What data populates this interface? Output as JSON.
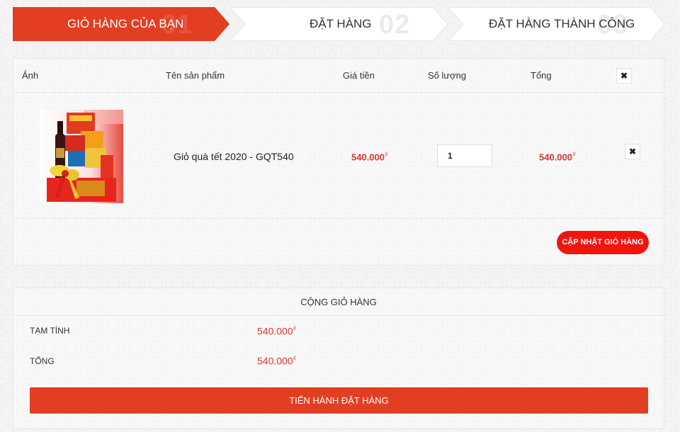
{
  "steps": [
    {
      "label": "GIỎ HÀNG CỦA BẠN",
      "number": "01",
      "active": true
    },
    {
      "label": "ĐẶT HÀNG",
      "number": "02",
      "active": false
    },
    {
      "label": "ĐẶT HÀNG THÀNH CÔNG",
      "number": "03",
      "active": false
    }
  ],
  "cart": {
    "headers": {
      "image": "Ảnh",
      "name": "Tên sản phẩm",
      "price": "Giá tiền",
      "quantity": "Số lượng",
      "total": "Tổng",
      "remove": "✖"
    },
    "items": [
      {
        "name": "Giỏ quà tết 2020 - GQT540",
        "price": "540.000",
        "quantity": "1",
        "total": "540.000",
        "remove": "✖"
      }
    ],
    "currency_symbol": "₫",
    "update_label": "CẬP NHẬT GIỎ HÀNG"
  },
  "totals": {
    "title": "CỘNG GIỎ HÀNG",
    "subtotal_label": "TẠM TÍNH",
    "subtotal_value": "540.000",
    "total_label": "TỔNG",
    "total_value": "540.000",
    "checkout_label": "TIẾN HÀNH ĐẶT HÀNG"
  },
  "colors": {
    "accent": "#e23e22",
    "price": "#d9382e",
    "update_button": "#f0160f"
  },
  "icons": {
    "remove": "close-icon",
    "product": "gift-basket-image"
  }
}
